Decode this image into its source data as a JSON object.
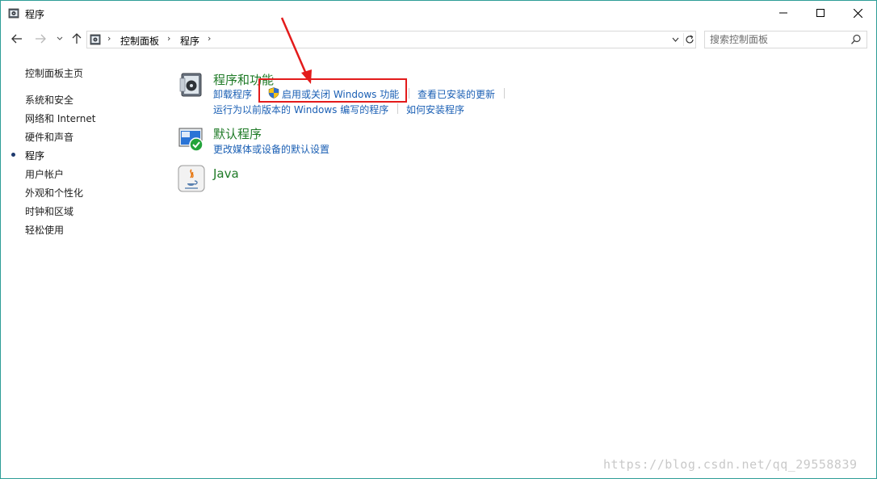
{
  "window": {
    "title": "程序",
    "border_color": "#2f9e97",
    "min_label": "minimize",
    "max_label": "maximize",
    "close_label": "close"
  },
  "address": {
    "breadcrumbs": [
      "控制面板",
      "程序"
    ],
    "search_placeholder": "搜索控制面板"
  },
  "sidebar": {
    "items": [
      {
        "label": "控制面板主页",
        "current": false
      },
      {
        "label": "系统和安全",
        "current": false
      },
      {
        "label": "网络和 Internet",
        "current": false
      },
      {
        "label": "硬件和声音",
        "current": false
      },
      {
        "label": "程序",
        "current": true
      },
      {
        "label": "用户帐户",
        "current": false
      },
      {
        "label": "外观和个性化",
        "current": false
      },
      {
        "label": "时钟和区域",
        "current": false
      },
      {
        "label": "轻松使用",
        "current": false
      }
    ]
  },
  "main": {
    "categories": [
      {
        "title": "程序和功能",
        "icon": "programs-and-features-icon",
        "links": [
          "卸载程序",
          "启用或关闭 Windows 功能",
          "查看已安装的更新",
          "运行为以前版本的 Windows 编写的程序",
          "如何安装程序"
        ]
      },
      {
        "title": "默认程序",
        "icon": "default-programs-icon",
        "links": [
          "更改媒体或设备的默认设置"
        ]
      },
      {
        "title": "Java",
        "icon": "java-icon",
        "links": []
      }
    ]
  },
  "annotation": {
    "highlight_color": "#e31b1b"
  },
  "watermark": "https://blog.csdn.net/qq_29558839",
  "colors": {
    "link": "#1a5fb4",
    "category_title": "#1e7a26"
  }
}
